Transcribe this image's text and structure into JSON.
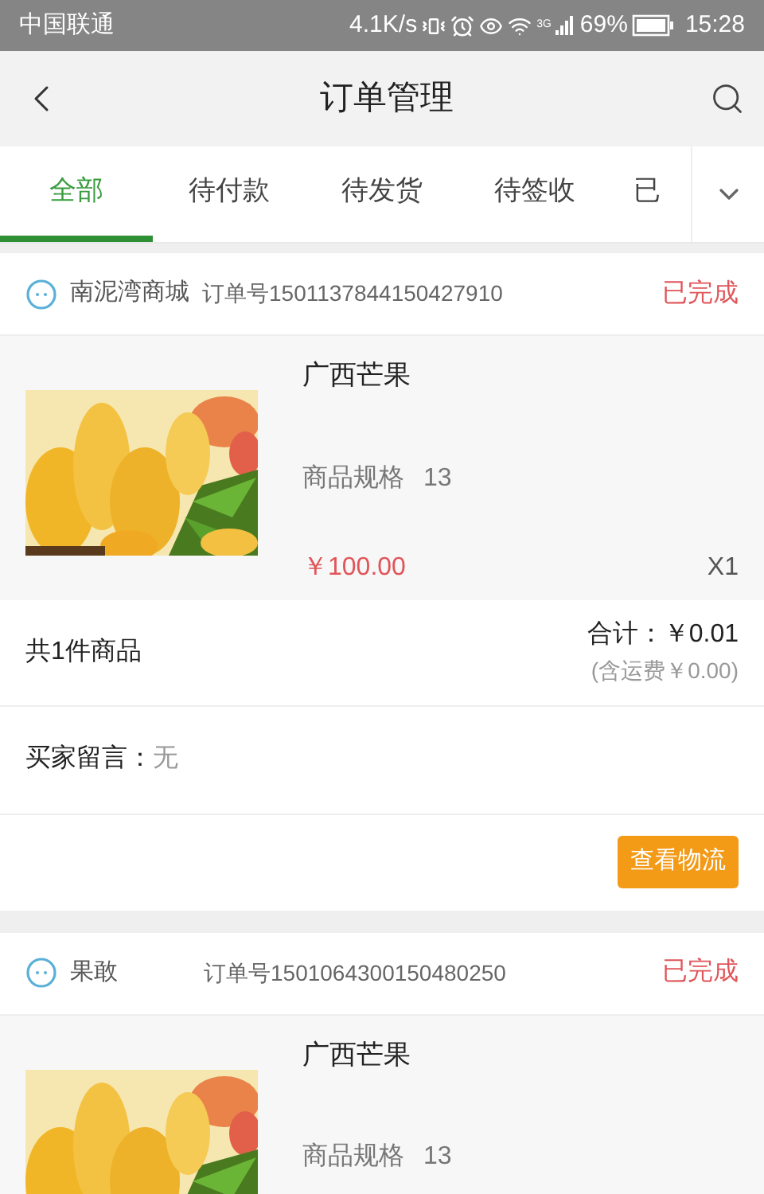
{
  "status_bar": {
    "carrier": "中国联通",
    "speed": "4.1K/s",
    "network": "3G",
    "battery": "69%",
    "time": "15:28"
  },
  "header": {
    "title": "订单管理"
  },
  "tabs": [
    {
      "label": "全部",
      "selected": true
    },
    {
      "label": "待付款",
      "selected": false
    },
    {
      "label": "待发货",
      "selected": false
    },
    {
      "label": "待签收",
      "selected": false
    },
    {
      "label": "已",
      "selected": false
    }
  ],
  "orders": [
    {
      "shop": "南泥湾商城",
      "order_no": "订单号1501137844150427910",
      "status": "已完成",
      "product": {
        "name": "广西芒果",
        "spec_label": "商品规格",
        "spec": "13",
        "price": "￥100.00",
        "quantity": "X1"
      },
      "count": "共1件商品",
      "total": "合计：￥0.01",
      "shipping": "(含运费￥0.00)",
      "message_label": "买家留言：",
      "message": "无",
      "action": "查看物流"
    },
    {
      "shop": "果敢",
      "order_no": "订单号1501064300150480250",
      "status": "已完成",
      "product": {
        "name": "广西芒果",
        "spec_label": "商品规格",
        "spec": "13"
      }
    }
  ]
}
